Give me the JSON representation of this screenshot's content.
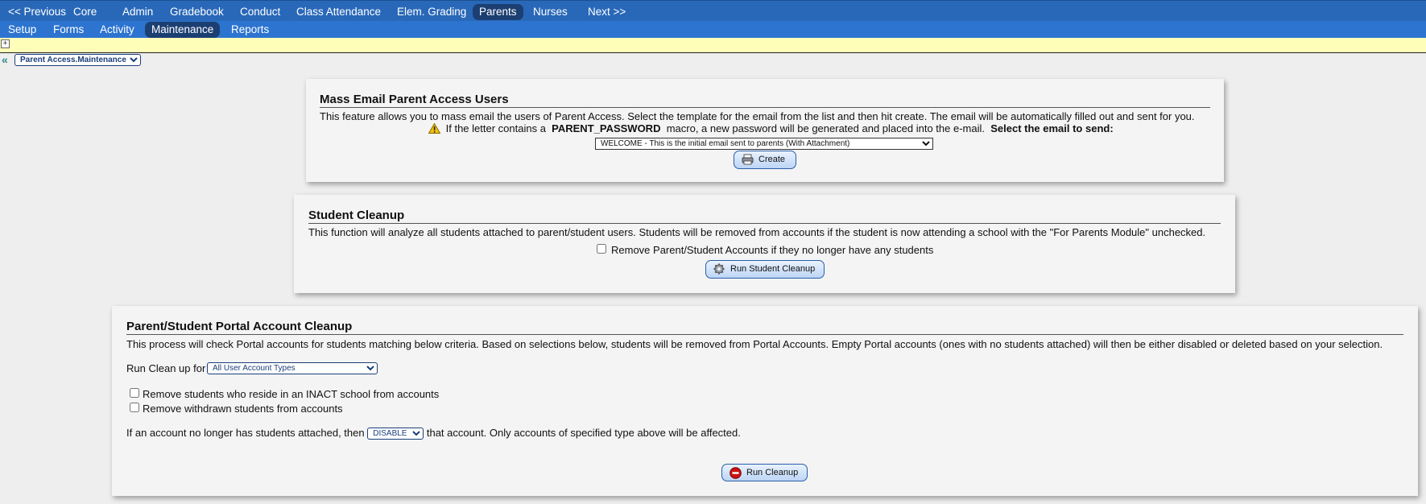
{
  "nav": {
    "primary": [
      {
        "label": "<< Previous",
        "name": "nav-previous"
      },
      {
        "label": "Core",
        "name": "nav-core"
      },
      {
        "label": "Admin",
        "name": "nav-admin"
      },
      {
        "label": "Gradebook",
        "name": "nav-gradebook"
      },
      {
        "label": "Conduct",
        "name": "nav-conduct"
      },
      {
        "label": "Class Attendance",
        "name": "nav-class-attendance"
      },
      {
        "label": "Elem. Grading",
        "name": "nav-elem-grading"
      },
      {
        "label": "Parents",
        "name": "nav-parents",
        "active": true
      },
      {
        "label": "Nurses",
        "name": "nav-nurses"
      },
      {
        "label": "Next >>",
        "name": "nav-next"
      }
    ],
    "secondary": [
      {
        "label": "Setup",
        "name": "subnav-setup"
      },
      {
        "label": "Forms",
        "name": "subnav-forms"
      },
      {
        "label": "Activity",
        "name": "subnav-activity"
      },
      {
        "label": "Maintenance",
        "name": "subnav-maintenance",
        "active": true
      },
      {
        "label": "Reports",
        "name": "subnav-reports"
      }
    ]
  },
  "toolbar": {
    "expand_symbol": "+"
  },
  "breadcrumb": {
    "chevron": "«",
    "selected": "Parent Access.Maintenance"
  },
  "mass_email": {
    "title": "Mass Email Parent Access Users",
    "description": "This feature allows you to mass email the users of Parent Access. Select the template for the email from the list and then hit create. The email will be automatically filled out and sent for you.",
    "warning_prefix": "If the letter contains a",
    "macro": "PARENT_PASSWORD",
    "warning_suffix": "macro, a new password will be generated and placed into the e-mail.",
    "select_label": "Select the email to send:",
    "template_selected": "WELCOME - This is the initial email sent to parents (With Attachment)",
    "create_label": "Create",
    "warning_icon": "warning-icon",
    "create_icon": "printer-icon"
  },
  "student_cleanup": {
    "title": "Student Cleanup",
    "description": "This function will analyze all students attached to parent/student users. Students will be removed from accounts if the student is now attending a school with the \"For Parents Module\" unchecked.",
    "remove_accounts_label": "Remove Parent/Student Accounts if they no longer have any students",
    "remove_accounts_checked": false,
    "run_label": "Run Student Cleanup",
    "run_icon": "gear-icon"
  },
  "portal_cleanup": {
    "title": "Parent/Student Portal Account Cleanup",
    "description": "This process will check Portal accounts for students matching below criteria. Based on selections below, students will be removed from Portal Accounts. Empty Portal accounts (ones with no students attached) will then be either disabled or deleted based on your selection.",
    "run_for_label": "Run Clean up for",
    "account_type_selected": "All User Account Types",
    "inact_label": "Remove students who reside in an INACT school from accounts",
    "inact_checked": false,
    "withdrawn_label": "Remove withdrawn students from accounts",
    "withdrawn_checked": false,
    "action_prefix": "If an account no longer has students attached, then",
    "action_selected": "DISABLE",
    "action_suffix": "that account. Only accounts of specified type above will be affected.",
    "run_label": "Run Cleanup",
    "run_icon": "stop-icon"
  },
  "colors": {
    "nav_bg": "#2968b8",
    "subnav_bg": "#2c74d0",
    "active_tab": "#1c3f72",
    "toolbar_bg": "#fffeb8",
    "page_bg": "#eeeeee",
    "panel_bg": "#f4f4f4",
    "stop_red": "#cc1111"
  }
}
